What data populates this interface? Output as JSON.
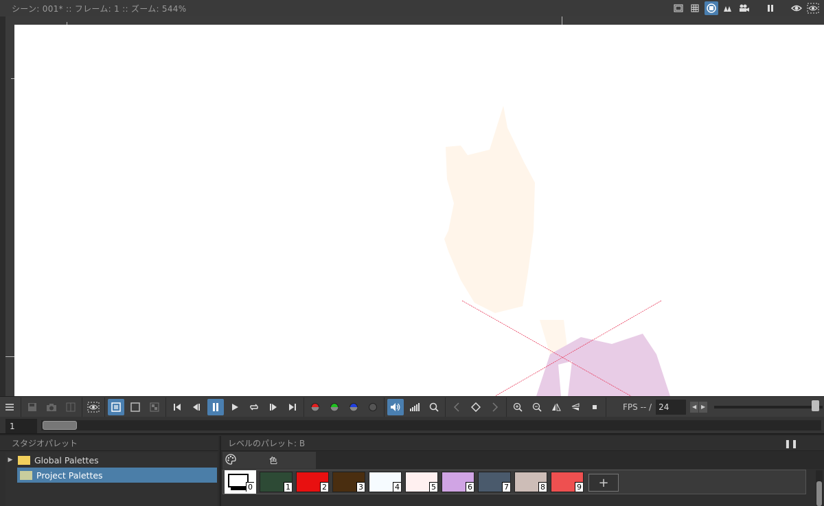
{
  "viewer": {
    "title": "シーン: 001*   ::   フレーム: 1   ::   ズーム: 544%",
    "header_icons": [
      "frame-icon",
      "grid-icon",
      "camera-stand-icon",
      "3d-icon",
      "movie-camera-icon",
      "pause-icon",
      "eye-icon",
      "eye-dashed-icon"
    ]
  },
  "playbar": {
    "fps_label": "FPS -- /",
    "fps_value": "24",
    "fps_slider_fraction": 0.92
  },
  "frame": {
    "value": "1"
  },
  "studio_palette": {
    "title": "スタジオパレット",
    "items": [
      {
        "label": "Global Palettes"
      },
      {
        "label": "Project Palettes"
      }
    ]
  },
  "level_palette": {
    "title": "レベルのパレット: B",
    "tab_label": "色",
    "chips": [
      {
        "index": "0",
        "color": "#ffffff"
      },
      {
        "index": "1",
        "color": "#2d4a35"
      },
      {
        "index": "2",
        "color": "#e81010"
      },
      {
        "index": "3",
        "color": "#4a2e10"
      },
      {
        "index": "4",
        "color": "#f6fbff"
      },
      {
        "index": "5",
        "color": "#fff0f0"
      },
      {
        "index": "6",
        "color": "#d0a4e4"
      },
      {
        "index": "7",
        "color": "#4a5a6c"
      },
      {
        "index": "8",
        "color": "#cdbdb7"
      },
      {
        "index": "9",
        "color": "#ee5050"
      }
    ],
    "add_label": "+"
  },
  "colors": {
    "accent": "#4a7fb0",
    "skin": "#fff6ec",
    "cloth": "#e8cce6",
    "guide": "#e83c5c"
  }
}
